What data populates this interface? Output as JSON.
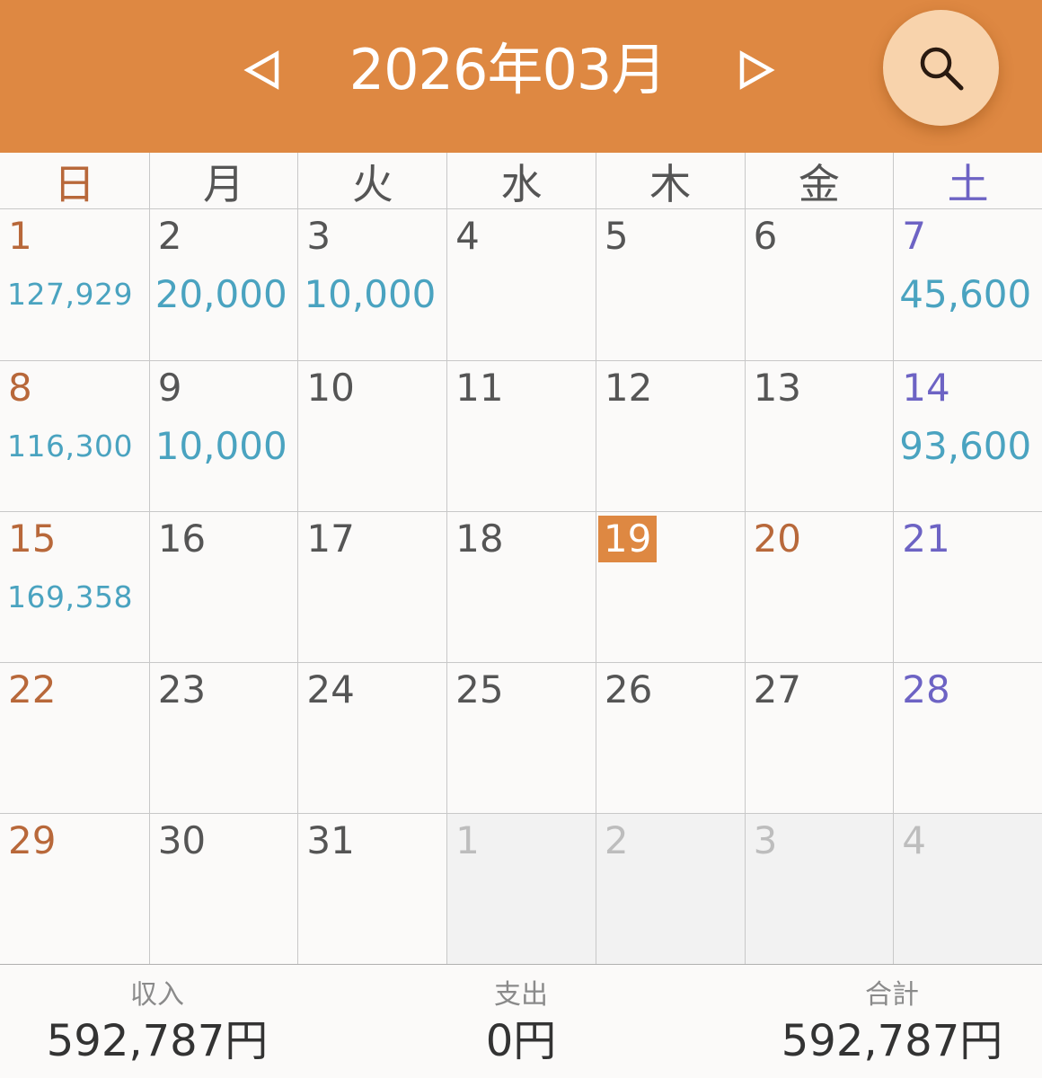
{
  "header": {
    "title": "2026年03月",
    "prev_icon": "triangle-left-icon",
    "next_icon": "triangle-right-icon",
    "search_icon": "magnifier-icon",
    "background": "#de8842"
  },
  "weekdays": [
    "日",
    "月",
    "火",
    "水",
    "木",
    "金",
    "土"
  ],
  "calendar": {
    "weeks": [
      [
        {
          "day": "1",
          "amount": "127,929",
          "size": "small"
        },
        {
          "day": "2",
          "amount": "20,000",
          "size": "big"
        },
        {
          "day": "3",
          "amount": "10,000",
          "size": "big"
        },
        {
          "day": "4",
          "amount": ""
        },
        {
          "day": "5",
          "amount": ""
        },
        {
          "day": "6",
          "amount": ""
        },
        {
          "day": "7",
          "amount": "45,600",
          "size": "big"
        }
      ],
      [
        {
          "day": "8",
          "amount": "116,300",
          "size": "small"
        },
        {
          "day": "9",
          "amount": "10,000",
          "size": "big"
        },
        {
          "day": "10",
          "amount": ""
        },
        {
          "day": "11",
          "amount": ""
        },
        {
          "day": "12",
          "amount": ""
        },
        {
          "day": "13",
          "amount": ""
        },
        {
          "day": "14",
          "amount": "93,600",
          "size": "big"
        }
      ],
      [
        {
          "day": "15",
          "amount": "169,358",
          "size": "small"
        },
        {
          "day": "16",
          "amount": ""
        },
        {
          "day": "17",
          "amount": ""
        },
        {
          "day": "18",
          "amount": ""
        },
        {
          "day": "19",
          "amount": "",
          "today": true
        },
        {
          "day": "20",
          "amount": "",
          "holiday": true
        },
        {
          "day": "21",
          "amount": ""
        }
      ],
      [
        {
          "day": "22",
          "amount": ""
        },
        {
          "day": "23",
          "amount": ""
        },
        {
          "day": "24",
          "amount": ""
        },
        {
          "day": "25",
          "amount": ""
        },
        {
          "day": "26",
          "amount": ""
        },
        {
          "day": "27",
          "amount": ""
        },
        {
          "day": "28",
          "amount": ""
        }
      ],
      [
        {
          "day": "29",
          "amount": ""
        },
        {
          "day": "30",
          "amount": ""
        },
        {
          "day": "31",
          "amount": ""
        },
        {
          "day": "1",
          "amount": "",
          "other": true
        },
        {
          "day": "2",
          "amount": "",
          "other": true
        },
        {
          "day": "3",
          "amount": "",
          "other": true
        },
        {
          "day": "4",
          "amount": "",
          "other": true
        }
      ]
    ]
  },
  "summary": {
    "income_label": "収入",
    "income_value": "592,787円",
    "expense_label": "支出",
    "expense_value": "0円",
    "total_label": "合計",
    "total_value": "592,787円"
  },
  "colors": {
    "accent": "#de8842",
    "sunday": "#b8683a",
    "saturday": "#6d63c4",
    "amount": "#4aa3c0"
  }
}
